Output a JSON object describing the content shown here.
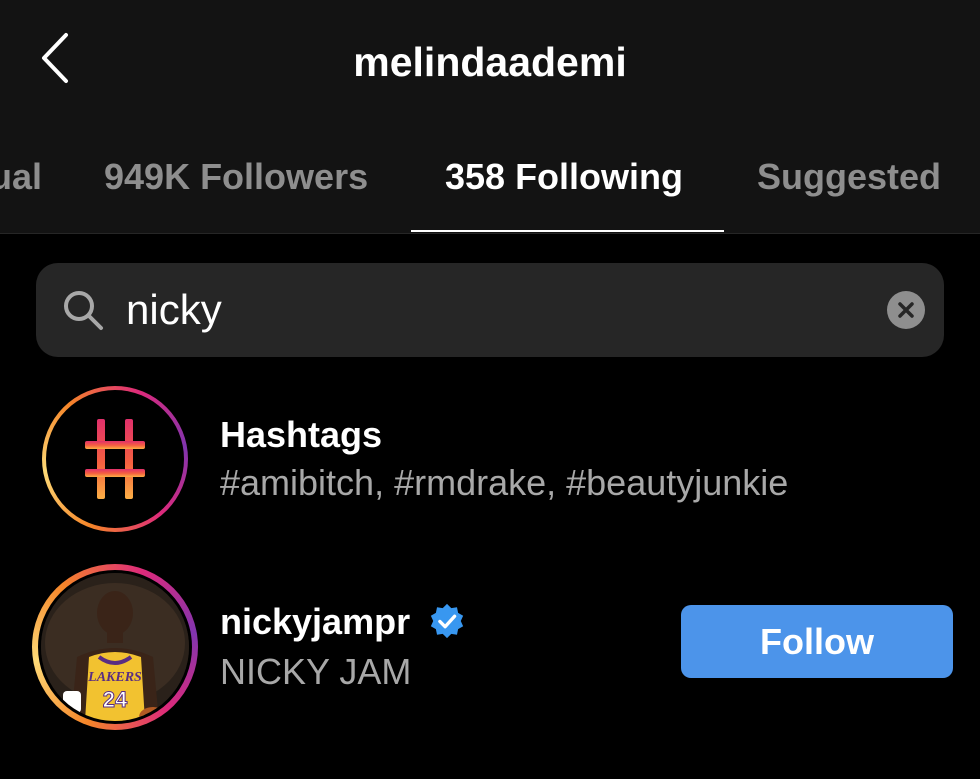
{
  "header": {
    "title": "melindaademi",
    "back_icon": "chevron-left-icon"
  },
  "tabs": [
    {
      "label": "ual",
      "active": false
    },
    {
      "label": "949K Followers",
      "active": false
    },
    {
      "label": "358 Following",
      "active": true
    },
    {
      "label": "Suggested",
      "active": false
    }
  ],
  "search": {
    "value": "nicky",
    "icon": "search-icon",
    "clear_icon": "clear-icon"
  },
  "results": {
    "hashtags": {
      "title": "Hashtags",
      "subtitle": "#amibitch, #rmdrake, #beautyjunkie",
      "icon": "hashtag-icon"
    },
    "user": {
      "username": "nickyjampr",
      "name": "NICKY JAM",
      "verified": true,
      "follow_label": "Follow",
      "jersey_text": "LAKERS",
      "jersey_number": "24"
    }
  },
  "colors": {
    "background": "#000000",
    "header_bg": "#131313",
    "search_bg": "#262626",
    "follow_button": "#4c94ea",
    "verified_badge": "#3897f0",
    "muted_text": "#8e8e8e"
  }
}
